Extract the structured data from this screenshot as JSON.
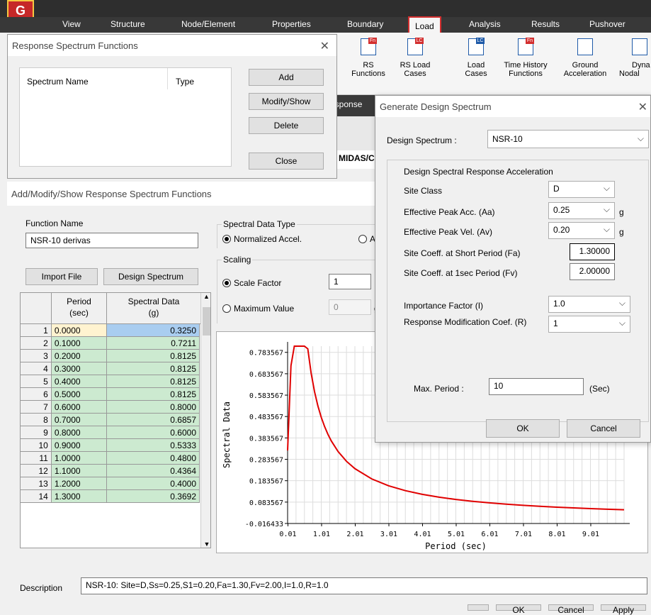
{
  "menu": {
    "tabs": [
      "View",
      "Structure",
      "Node/Element",
      "Properties",
      "Boundary",
      "Load",
      "Analysis",
      "Results",
      "Pushover"
    ],
    "active": "Load"
  },
  "ribbon": {
    "items": [
      {
        "line1": "RS",
        "line2": "Functions",
        "tag": "Fn"
      },
      {
        "line1": "RS Load",
        "line2": "Cases",
        "tag": "LC"
      },
      {
        "line1": "Load",
        "line2": "Cases",
        "tag": "LC"
      },
      {
        "line1": "Time History",
        "line2": "Functions",
        "tag": "Fn"
      },
      {
        "line1": "Ground",
        "line2": "Acceleration",
        "tag": ""
      },
      {
        "line1": "Dyna",
        "line2": "Nodal",
        "tag": ""
      }
    ]
  },
  "rs_functions": {
    "title": "Response Spectrum Functions",
    "col_name": "Spectrum Name",
    "col_type": "Type",
    "add": "Add",
    "modify": "Modify/Show",
    "delete": "Delete",
    "close": "Close"
  },
  "background_fragments": {
    "frag1": "esponse",
    "frag2": "MIDAS/C",
    "frag3": "A"
  },
  "main": {
    "title": "Add/Modify/Show Response Spectrum Functions",
    "function_name_label": "Function Name",
    "function_name": "NSR-10 derivas",
    "import_file": "Import File",
    "design_spectrum": "Design Spectrum",
    "spectral_type_label": "Spectral Data Type",
    "normalized": "Normalized Accel.",
    "scaling_label": "Scaling",
    "scale_factor": "Scale Factor",
    "scale_value": "1",
    "max_value": "Maximum Value",
    "max_input": "0",
    "max_unit": "g",
    "col_period": "Period",
    "col_period_unit": "(sec)",
    "col_spectral": "Spectral Data",
    "col_spectral_unit": "(g)",
    "rows": [
      {
        "n": "1",
        "p": "0.0000",
        "s": "0.3250"
      },
      {
        "n": "2",
        "p": "0.1000",
        "s": "0.7211"
      },
      {
        "n": "3",
        "p": "0.2000",
        "s": "0.8125"
      },
      {
        "n": "4",
        "p": "0.3000",
        "s": "0.8125"
      },
      {
        "n": "5",
        "p": "0.4000",
        "s": "0.8125"
      },
      {
        "n": "6",
        "p": "0.5000",
        "s": "0.8125"
      },
      {
        "n": "7",
        "p": "0.6000",
        "s": "0.8000"
      },
      {
        "n": "8",
        "p": "0.7000",
        "s": "0.6857"
      },
      {
        "n": "9",
        "p": "0.8000",
        "s": "0.6000"
      },
      {
        "n": "10",
        "p": "0.9000",
        "s": "0.5333"
      },
      {
        "n": "11",
        "p": "1.0000",
        "s": "0.4800"
      },
      {
        "n": "12",
        "p": "1.1000",
        "s": "0.4364"
      },
      {
        "n": "13",
        "p": "1.2000",
        "s": "0.4000"
      },
      {
        "n": "14",
        "p": "1.3000",
        "s": "0.3692"
      }
    ],
    "description_label": "Description",
    "description": "NSR-10: Site=D,Ss=0.25,S1=0.20,Fa=1.30,Fv=2.00,I=1.0,R=1.0",
    "ok": "OK",
    "cancel": "Cancel",
    "apply": "Apply"
  },
  "chart_data": {
    "type": "line",
    "xlabel": "Period (sec)",
    "ylabel": "Spectral Data",
    "x_ticks": [
      "0.01",
      "1.01",
      "2.01",
      "3.01",
      "4.01",
      "5.01",
      "6.01",
      "7.01",
      "8.01",
      "9.01"
    ],
    "y_ticks": [
      "0.783567",
      "0.683567",
      "0.583567",
      "0.483567",
      "0.383567",
      "0.283567",
      "0.183567",
      "0.083567",
      "-0.016433"
    ],
    "xlim": [
      0,
      10
    ],
    "ylim": [
      -0.016433,
      0.8125
    ],
    "line_color": "#e00000",
    "x": [
      0,
      0.1,
      0.2,
      0.3,
      0.4,
      0.5,
      0.6,
      0.7,
      0.8,
      0.9,
      1.0,
      1.1,
      1.2,
      1.3,
      1.5,
      1.75,
      2.0,
      2.5,
      3,
      3.5,
      4,
      4.5,
      5,
      5.5,
      6,
      6.5,
      7,
      7.5,
      8,
      8.5,
      9,
      9.5,
      10
    ],
    "y": [
      0.325,
      0.7211,
      0.8125,
      0.8125,
      0.8125,
      0.8125,
      0.8,
      0.6857,
      0.6,
      0.5333,
      0.48,
      0.4364,
      0.4,
      0.3692,
      0.32,
      0.2743,
      0.24,
      0.192,
      0.16,
      0.1371,
      0.12,
      0.1067,
      0.096,
      0.0873,
      0.08,
      0.0738,
      0.0686,
      0.064,
      0.06,
      0.0565,
      0.0533,
      0.0505,
      0.048
    ]
  },
  "gds": {
    "title": "Generate Design Spectrum",
    "design_spectrum_label": "Design Spectrum :",
    "design_spectrum_value": "NSR-10",
    "group_title": "Design Spectral Response Acceleration",
    "site_class_label": "Site Class",
    "site_class_value": "D",
    "aa_label": "Effective Peak Acc. (Aa)",
    "aa_value": "0.25",
    "av_label": "Effective Peak Vel. (Av)",
    "av_value": "0.20",
    "unit_g": "g",
    "fa_label": "Site Coeff. at Short Period (Fa)",
    "fa_value": "1.30000",
    "fv_label": "Site Coeff. at 1sec Period (Fv)",
    "fv_value": "2.00000",
    "imp_label": "Importance Factor (I)",
    "imp_value": "1.0",
    "rmc_label": "Response Modification Coef. (R)",
    "rmc_value": "1",
    "max_period_label": "Max. Period :",
    "max_period_value": "10",
    "max_period_unit": "(Sec)",
    "ok": "OK",
    "cancel": "Cancel"
  }
}
